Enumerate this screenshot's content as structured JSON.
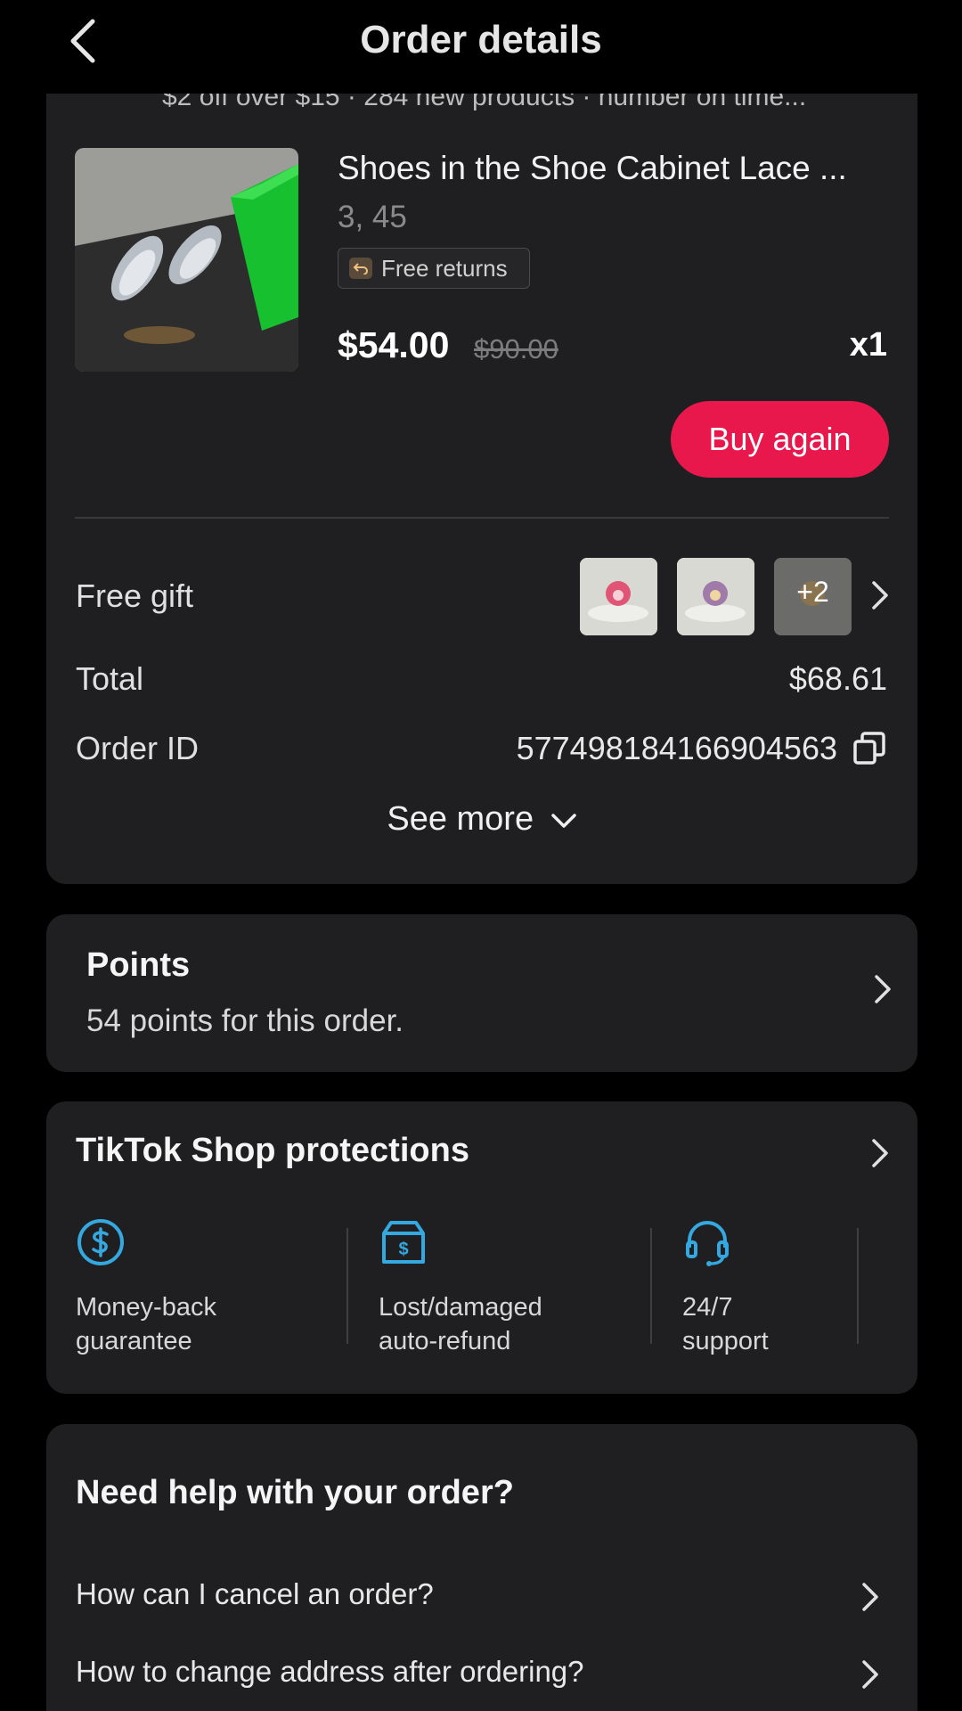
{
  "header": {
    "title": "Order details"
  },
  "banner": {
    "text": "$2 off over $15 · 284 new products · number on time..."
  },
  "product": {
    "name": "Shoes in the Shoe Cabinet Lace ...",
    "variant": "3, 45",
    "badge": "Free returns",
    "price": "$54.00",
    "old_price": "$90.00",
    "quantity": "x1",
    "buy_again": "Buy again"
  },
  "summary": {
    "free_gift_label": "Free gift",
    "gift_more": "+2",
    "total_label": "Total",
    "total_value": "$68.61",
    "order_id_label": "Order ID",
    "order_id_value": "577498184166904563",
    "see_more": "See more"
  },
  "points": {
    "title": "Points",
    "subtitle": "54 points for this order."
  },
  "protections": {
    "title": "TikTok Shop protections",
    "items": [
      {
        "icon": "dollar-circle-icon",
        "label": "Money-back\nguarantee"
      },
      {
        "icon": "box-refund-icon",
        "label": "Lost/damaged\nauto-refund"
      },
      {
        "icon": "headset-icon",
        "label": "24/7\nsupport"
      }
    ],
    "accent": "#35a8e0"
  },
  "help": {
    "title": "Need help with your order?",
    "questions": [
      "How can I cancel an order?",
      "How to change address after ordering?"
    ]
  },
  "colors": {
    "accent": "#e8184d",
    "card": "#1f1f21",
    "background": "#000000"
  }
}
